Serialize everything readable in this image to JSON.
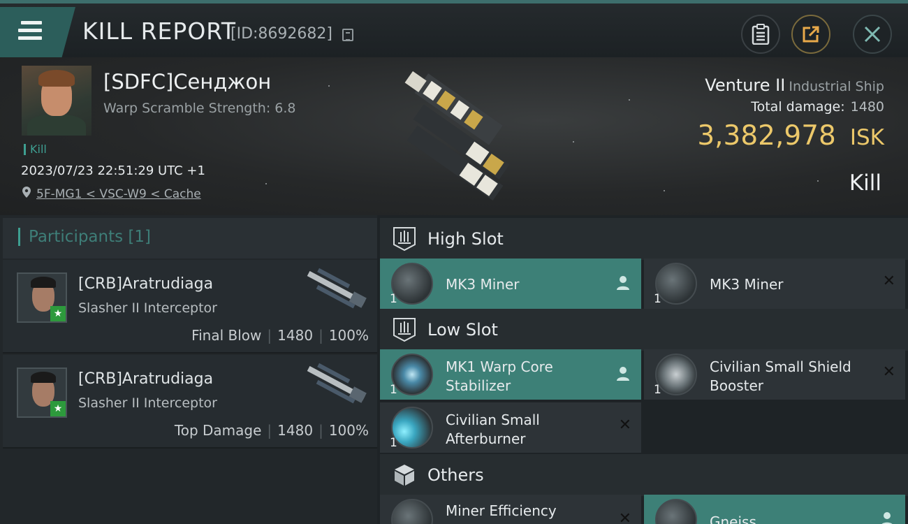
{
  "header": {
    "title": "KILL REPORT",
    "report_id": "[ID:8692682]"
  },
  "victim": {
    "name": "[SDFC]Сенджон",
    "warp_scramble": "Warp Scramble Strength: 6.8",
    "kill_tag": "Kill",
    "datetime": "2023/07/23 22:51:29 UTC +1",
    "location": "5F-MG1 < VSC-W9 < Cache",
    "ship_name": "Venture II",
    "ship_class": "Industrial Ship",
    "total_damage_label": "Total damage:",
    "total_damage": "1480",
    "isk_value": "3,382,978",
    "isk_unit": "ISK",
    "result": "Kill"
  },
  "participants": {
    "header": "Participants [1]",
    "rows": [
      {
        "name": "[CRB]Aratrudiaga",
        "ship": "Slasher II Interceptor",
        "role": "Final Blow",
        "damage": "1480",
        "percent": "100%"
      },
      {
        "name": "[CRB]Aratrudiaga",
        "ship": "Slasher II Interceptor",
        "role": "Top Damage",
        "damage": "1480",
        "percent": "100%"
      }
    ]
  },
  "fitting": {
    "high_slot": {
      "label": "High Slot",
      "items": [
        {
          "name": "MK3 Miner",
          "qty": "1",
          "state": "active"
        },
        {
          "name": "MK3 Miner",
          "qty": "1",
          "state": "destroyed"
        }
      ]
    },
    "low_slot": {
      "label": "Low Slot",
      "items": [
        {
          "name": "MK1 Warp Core Stabilizer",
          "qty": "1",
          "state": "active"
        },
        {
          "name": "Civilian Small Shield Booster",
          "qty": "1",
          "state": "destroyed"
        },
        {
          "name": "Civilian Small Afterburner",
          "qty": "1",
          "state": "destroyed"
        }
      ]
    },
    "others": {
      "label": "Others",
      "items": [
        {
          "name": "Miner Efficiency",
          "state": "destroyed"
        },
        {
          "name": "Gneiss",
          "state": "active"
        }
      ]
    }
  },
  "colors": {
    "accent_teal": "#3d8077",
    "isk_gold": "#ecc86a",
    "badge_green": "#2d9a3c"
  }
}
